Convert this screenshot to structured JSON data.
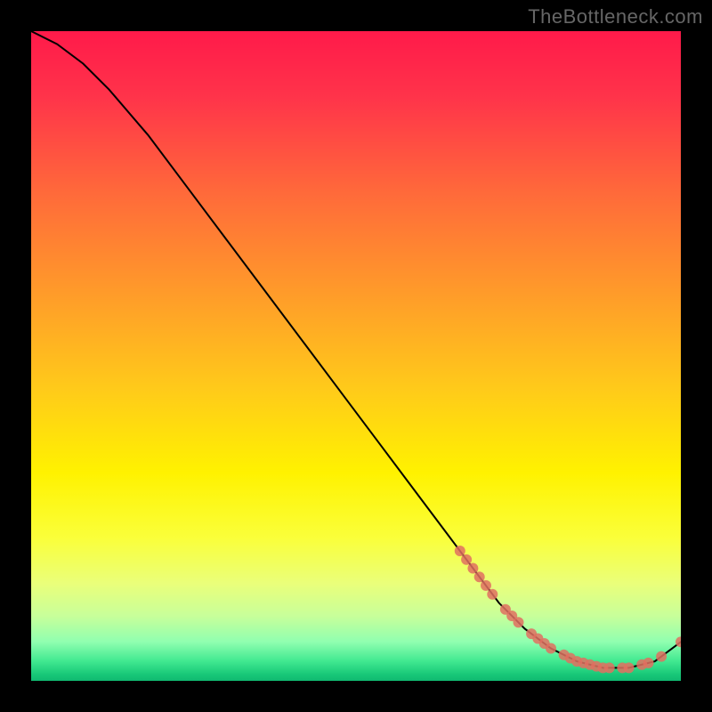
{
  "watermark": "TheBottleneck.com",
  "chart_data": {
    "type": "line",
    "title": "",
    "xlabel": "",
    "ylabel": "",
    "xlim": [
      0,
      100
    ],
    "ylim": [
      0,
      100
    ],
    "grid": false,
    "series": [
      {
        "name": "bottleneck-curve",
        "color": "#000000",
        "x": [
          0,
          4,
          8,
          12,
          18,
          24,
          30,
          36,
          42,
          48,
          54,
          60,
          66,
          72,
          76,
          80,
          84,
          88,
          92,
          96,
          100
        ],
        "y": [
          100,
          98,
          95,
          91,
          84,
          76,
          68,
          60,
          52,
          44,
          36,
          28,
          20,
          12,
          8,
          5,
          3,
          2,
          2,
          3,
          6
        ]
      }
    ],
    "markers": {
      "comment": "salmon dotted markers along the curve, clustered on the descending tail and flat valley",
      "color": "#e07060",
      "points_x": [
        66,
        67,
        68,
        69,
        70,
        71,
        73,
        74,
        75,
        77,
        78,
        79,
        80,
        82,
        83,
        84,
        85,
        86,
        87,
        88,
        89,
        91,
        92,
        94,
        95,
        97,
        100
      ],
      "radius": 6
    },
    "background_gradient": {
      "direction": "vertical",
      "stops": [
        {
          "pos": 0.0,
          "color": "#ff1a4a"
        },
        {
          "pos": 0.25,
          "color": "#ff6a3a"
        },
        {
          "pos": 0.55,
          "color": "#ffca1a"
        },
        {
          "pos": 0.78,
          "color": "#faff3a"
        },
        {
          "pos": 0.94,
          "color": "#90ffb0"
        },
        {
          "pos": 1.0,
          "color": "#10b870"
        }
      ]
    }
  }
}
